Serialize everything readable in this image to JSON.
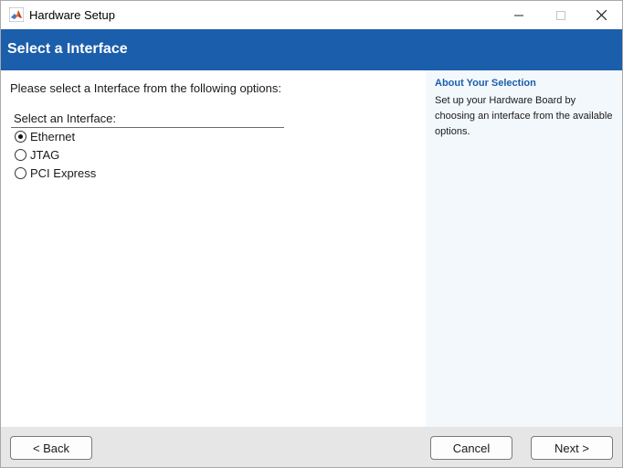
{
  "window": {
    "title": "Hardware Setup",
    "icon": "matlab-icon",
    "controls": [
      "minimize-icon",
      "maximize-icon",
      "close-icon"
    ]
  },
  "banner": {
    "title": "Select a Interface",
    "color": "#1b5eab"
  },
  "main": {
    "instruction": "Please select a Interface from the following options:",
    "group_label": "Select an Interface:",
    "options": [
      {
        "label": "Ethernet",
        "selected": true
      },
      {
        "label": "JTAG",
        "selected": false
      },
      {
        "label": "PCI Express",
        "selected": false
      }
    ]
  },
  "side_panel": {
    "title": "About Your Selection",
    "text": "Set up your Hardware Board by choosing an interface from the available options.",
    "background": "#f3f8fd"
  },
  "footer": {
    "back_label": "< Back",
    "cancel_label": "Cancel",
    "next_label": "Next >"
  }
}
